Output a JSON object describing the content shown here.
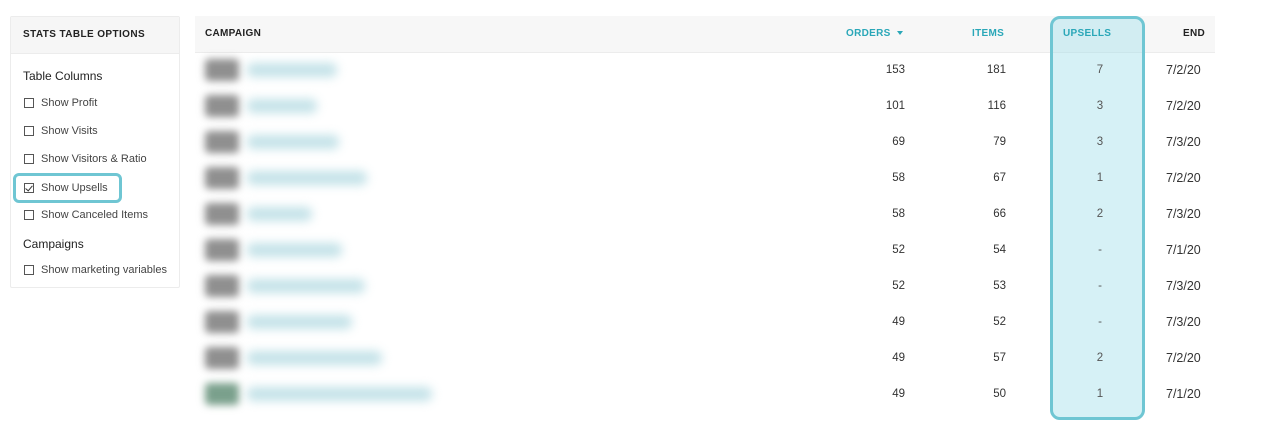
{
  "options_panel": {
    "header": "STATS TABLE OPTIONS",
    "sections": [
      {
        "title": "Table Columns",
        "items": [
          {
            "label": "Show Profit",
            "checked": false
          },
          {
            "label": "Show Visits",
            "checked": false
          },
          {
            "label": "Show Visitors & Ratio",
            "checked": false
          },
          {
            "label": "Show Upsells",
            "checked": true
          },
          {
            "label": "Show Canceled Items",
            "checked": false
          }
        ]
      },
      {
        "title": "Campaigns",
        "items": [
          {
            "label": "Show marketing variables",
            "checked": false
          }
        ]
      }
    ]
  },
  "table": {
    "headers": {
      "campaign": "CAMPAIGN",
      "orders": "ORDERS",
      "items": "ITEMS",
      "upsells": "UPSELLS",
      "end": "END"
    },
    "sort": {
      "column": "orders",
      "direction": "desc"
    },
    "rows": [
      {
        "orders": "153",
        "items": "181",
        "upsells": "7",
        "end": "7/2/20"
      },
      {
        "orders": "101",
        "items": "116",
        "upsells": "3",
        "end": "7/2/20"
      },
      {
        "orders": "69",
        "items": "79",
        "upsells": "3",
        "end": "7/3/20"
      },
      {
        "orders": "58",
        "items": "67",
        "upsells": "1",
        "end": "7/2/20"
      },
      {
        "orders": "58",
        "items": "66",
        "upsells": "2",
        "end": "7/3/20"
      },
      {
        "orders": "52",
        "items": "54",
        "upsells": "-",
        "end": "7/1/20"
      },
      {
        "orders": "52",
        "items": "53",
        "upsells": "-",
        "end": "7/3/20"
      },
      {
        "orders": "49",
        "items": "52",
        "upsells": "-",
        "end": "7/3/20"
      },
      {
        "orders": "49",
        "items": "57",
        "upsells": "2",
        "end": "7/2/20"
      },
      {
        "orders": "49",
        "items": "50",
        "upsells": "1",
        "end": "7/1/20"
      }
    ]
  },
  "colors": {
    "accent": "#2aa7b8",
    "highlight_border": "#6fc6d3",
    "highlight_fill": "#a3e0ec"
  }
}
